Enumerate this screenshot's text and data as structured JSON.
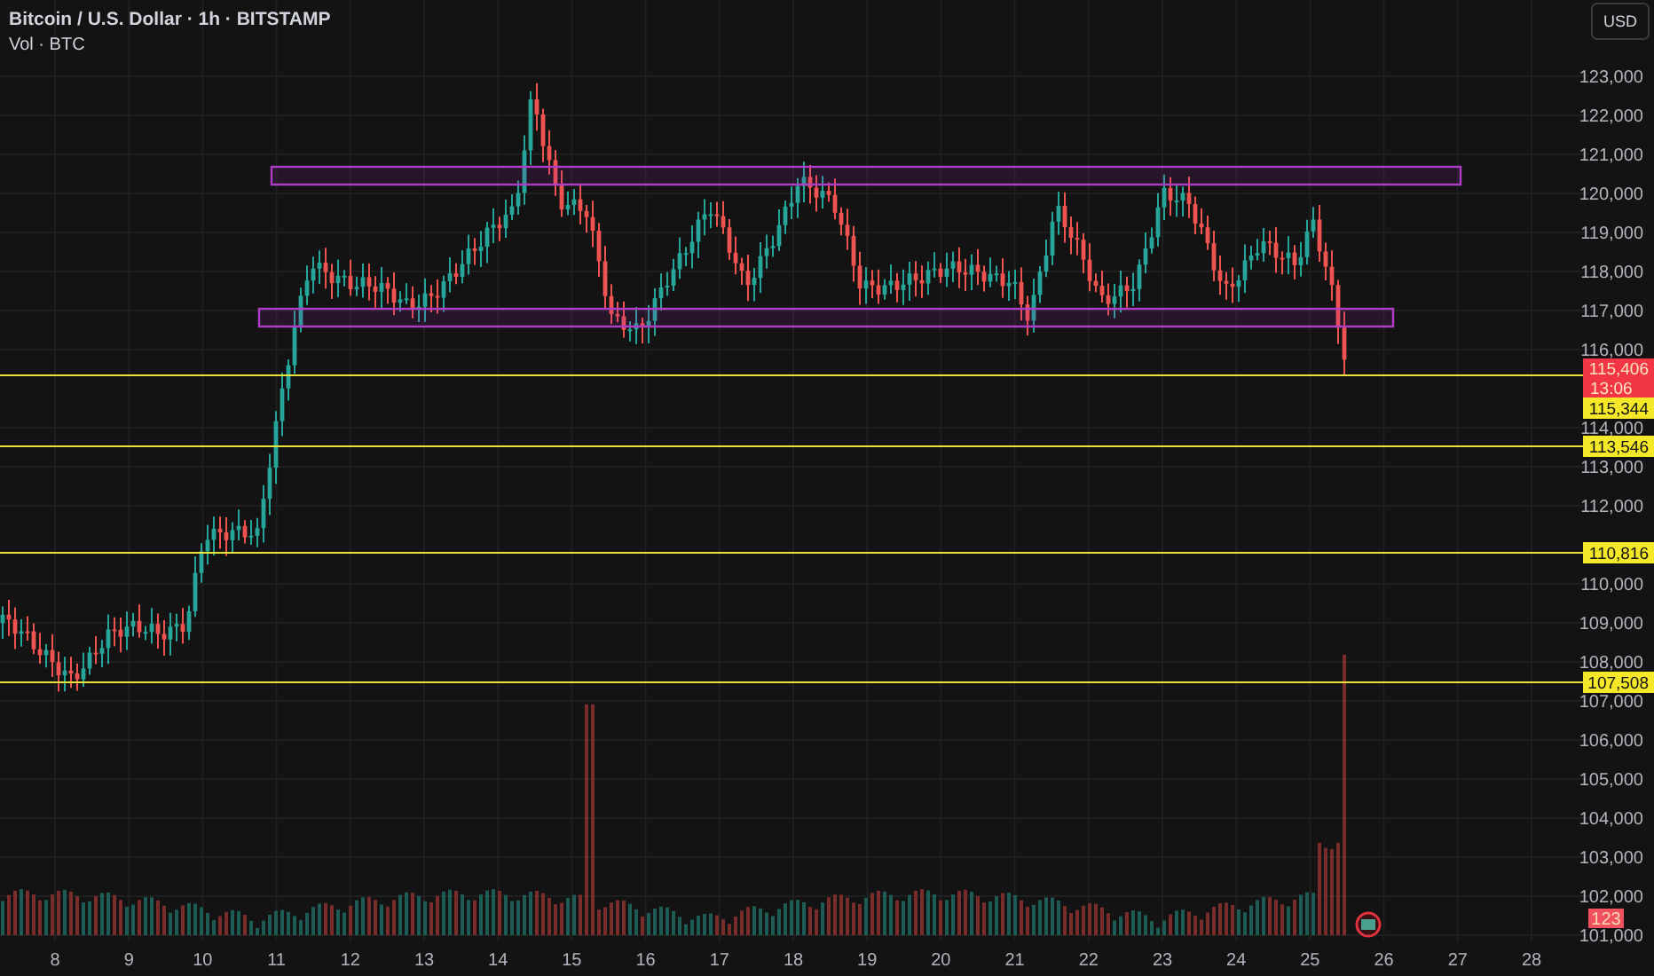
{
  "header": {
    "title": "Bitcoin / U.S. Dollar · 1h · BITSTAMP",
    "volume_label": "Vol · BTC"
  },
  "currency_button": "USD",
  "price_axis": [
    "123,000",
    "122,000",
    "121,000",
    "120,000",
    "119,000",
    "118,000",
    "117,000",
    "116,000",
    "114,000",
    "113,000",
    "112,000",
    "110,000",
    "109,000",
    "108,000",
    "107,000",
    "106,000",
    "105,000",
    "104,000",
    "103,000",
    "102,000",
    "101,000"
  ],
  "time_axis": [
    "8",
    "9",
    "10",
    "11",
    "12",
    "13",
    "14",
    "15",
    "16",
    "17",
    "18",
    "19",
    "20",
    "21",
    "22",
    "23",
    "24",
    "25",
    "26",
    "27",
    "28"
  ],
  "levels": [
    {
      "label": "115,344"
    },
    {
      "label": "113,546"
    },
    {
      "label": "110,816"
    },
    {
      "label": "107,508"
    }
  ],
  "last_price": {
    "price": "115,406",
    "countdown": "13:06"
  },
  "volume_tag": "123"
}
